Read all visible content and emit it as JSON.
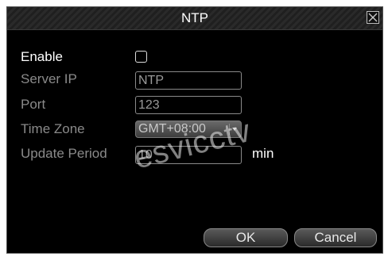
{
  "dialog": {
    "title": "NTP"
  },
  "form": {
    "enable_label": "Enable",
    "enable_checked": false,
    "server_ip_label": "Server IP",
    "server_ip_value": "NTP",
    "port_label": "Port",
    "port_value": "123",
    "time_zone_label": "Time Zone",
    "time_zone_value": "GMT+08:00",
    "update_period_label": "Update Period",
    "update_period_value": "10",
    "update_period_unit": "min"
  },
  "buttons": {
    "ok_label": "OK",
    "cancel_label": "Cancel"
  },
  "watermark": {
    "text": "esvicctv"
  },
  "colors": {
    "dialog_bg": "#000000",
    "enabled_text": "#ffffff",
    "disabled_text": "#8a8a8a"
  },
  "icons": {
    "close": "close-x-icon",
    "dropdown": "chevron-down-icon"
  }
}
